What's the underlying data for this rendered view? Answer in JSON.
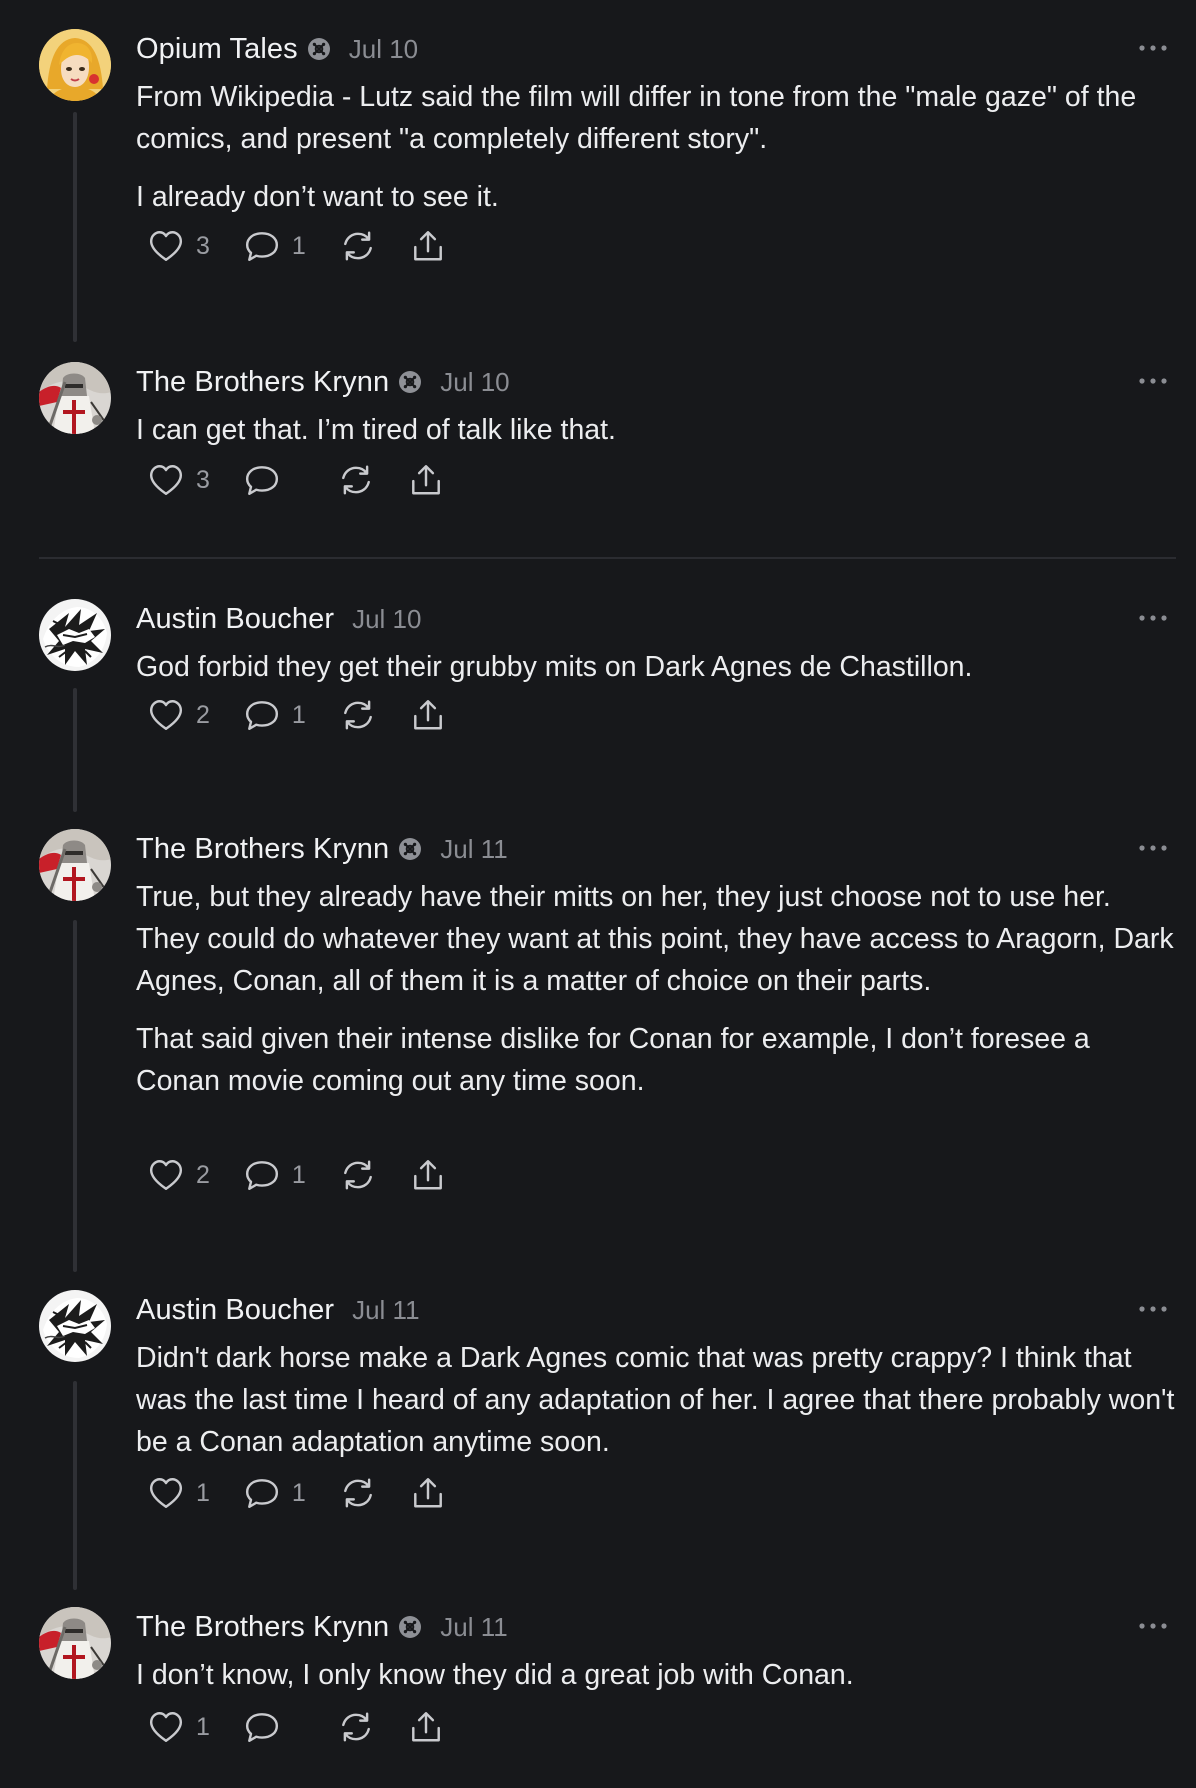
{
  "comments": [
    {
      "author": "Opium Tales",
      "verified": true,
      "date": "Jul 10",
      "paragraphs": [
        "From Wikipedia - Lutz said the film will differ in tone from the \"male gaze\" of the comics, and present \"a completely different story\".",
        "I already don’t want to see it."
      ],
      "likes": "3",
      "replies": "1",
      "avatar_icon": "blonde-character-avatar"
    },
    {
      "author": "The Brothers Krynn",
      "verified": true,
      "date": "Jul 10",
      "paragraphs": [
        "I can get that. I’m tired of talk like that."
      ],
      "likes": "3",
      "replies": "",
      "avatar_icon": "knight-avatar"
    },
    {
      "author": "Austin Boucher",
      "verified": false,
      "date": "Jul 10",
      "paragraphs": [
        "God forbid they get their grubby mits on Dark Agnes de Chastillon."
      ],
      "likes": "2",
      "replies": "1",
      "avatar_icon": "sketch-avatar"
    },
    {
      "author": "The Brothers Krynn",
      "verified": true,
      "date": "Jul 11",
      "paragraphs": [
        "True, but they already have their mitts on her, they just choose not to use her. They could do whatever they want at this point, they have access to Aragorn, Dark Agnes, Conan, all of them it is a matter of choice on their parts.",
        "That said given their intense dislike for Conan for example, I don’t foresee a Conan movie coming out any time soon."
      ],
      "likes": "2",
      "replies": "1",
      "avatar_icon": "knight-avatar"
    },
    {
      "author": "Austin Boucher",
      "verified": false,
      "date": "Jul 11",
      "paragraphs": [
        "Didn't dark horse make a Dark Agnes comic that was pretty crappy? I think that was the last time I heard of any adaptation of her. I agree that there probably won't be a Conan adaptation anytime soon."
      ],
      "likes": "1",
      "replies": "1",
      "avatar_icon": "sketch-avatar"
    },
    {
      "author": "The Brothers Krynn",
      "verified": true,
      "date": "Jul 11",
      "paragraphs": [
        "I don’t know, I only know they did a great job with Conan."
      ],
      "likes": "1",
      "replies": "",
      "avatar_icon": "knight-avatar"
    }
  ],
  "colors": {
    "background": "#17181b",
    "text": "#ecedef",
    "muted": "#8b8d93",
    "thread_line": "#2f3035",
    "icon": "#c9cace"
  }
}
